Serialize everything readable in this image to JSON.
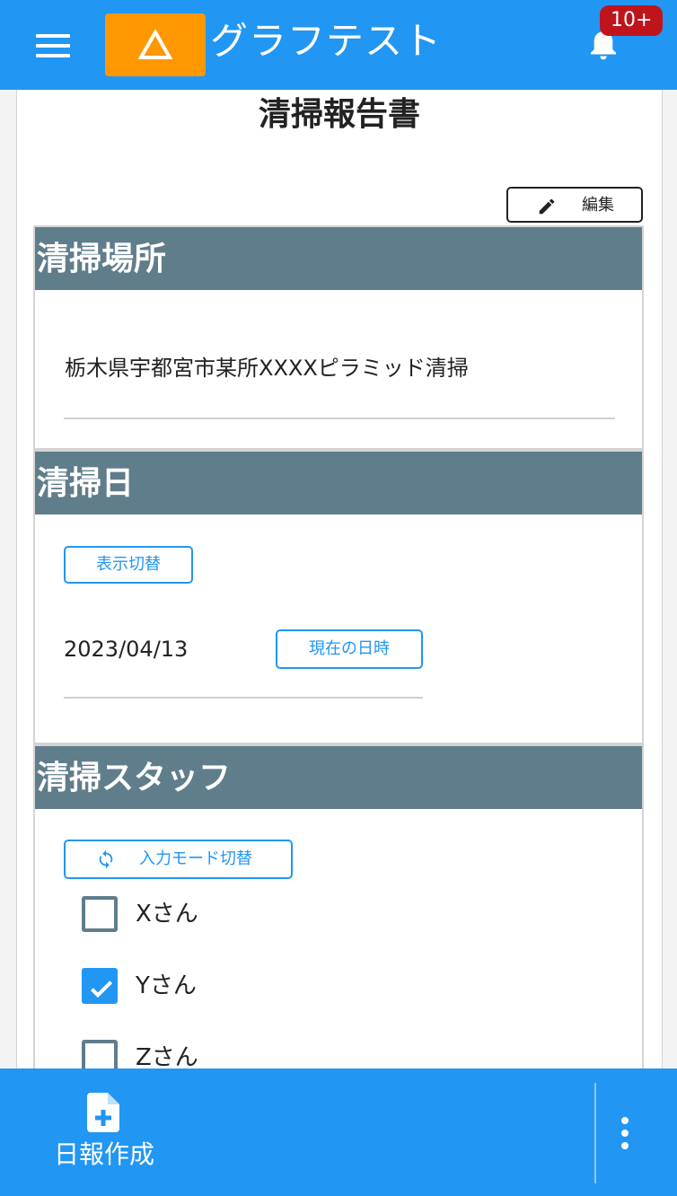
{
  "header": {
    "app_title": "グラフテスト",
    "notification_count": "10+"
  },
  "page": {
    "title": "清掃報告書",
    "edit_label": "編集"
  },
  "sections": {
    "place": {
      "heading": "清掃場所",
      "value": "栃木県宇都宮市某所XXXXピラミッド清掃"
    },
    "date": {
      "heading": "清掃日",
      "toggle_label": "表示切替",
      "value": "2023/04/13",
      "now_label": "現在の日時"
    },
    "staff": {
      "heading": "清掃スタッフ",
      "mode_toggle_label": "入力モード切替",
      "members": [
        {
          "name": "Xさん",
          "checked": false
        },
        {
          "name": "Yさん",
          "checked": true
        },
        {
          "name": "Zさん",
          "checked": false
        }
      ]
    }
  },
  "footer": {
    "create_label": "日報作成"
  },
  "colors": {
    "primary": "#2196f3",
    "logo": "#ff9800",
    "section_header": "#607d8b",
    "badge": "#c0141d"
  },
  "icons": {
    "menu": "hamburger-icon",
    "logo": "triangle-icon",
    "notification": "bell-icon",
    "edit": "pencil-icon",
    "mode_toggle": "sync-icon",
    "create": "file-plus-icon",
    "more": "more-vertical-icon"
  }
}
